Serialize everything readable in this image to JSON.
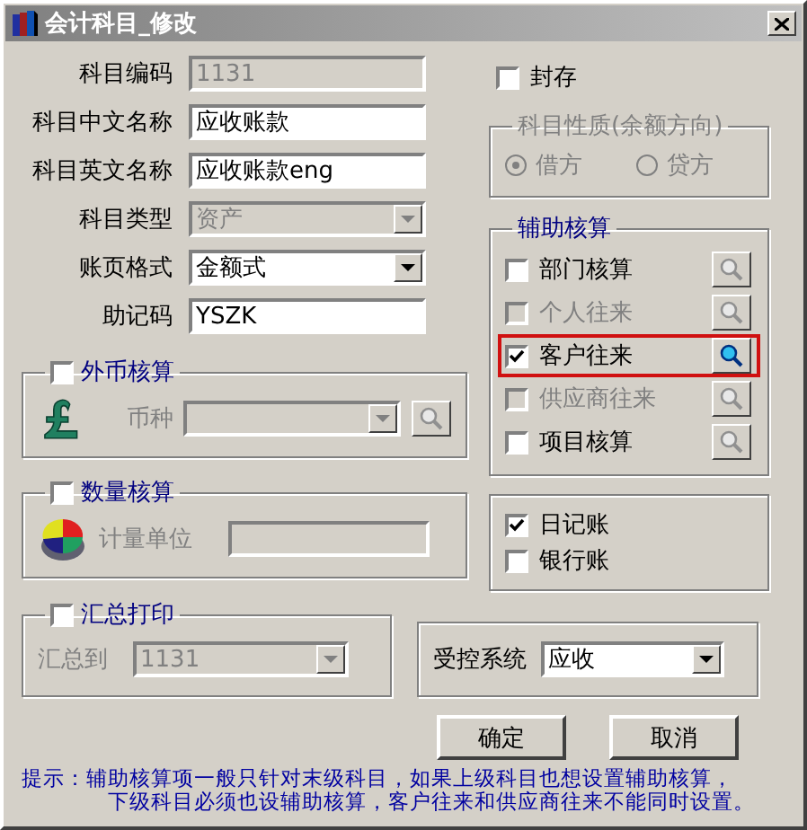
{
  "window": {
    "title": "会计科目_修改"
  },
  "fields": [
    {
      "label": "科目编码",
      "kind": "text",
      "value": "1131",
      "disabled": true
    },
    {
      "label": "科目中文名称",
      "kind": "text",
      "value": "应收账款",
      "disabled": false
    },
    {
      "label": "科目英文名称",
      "kind": "text",
      "value": "应收账款eng",
      "disabled": false
    },
    {
      "label": "科目类型",
      "kind": "select",
      "value": "资产",
      "disabled": true
    },
    {
      "label": "账页格式",
      "kind": "select",
      "value": "金额式",
      "disabled": false
    },
    {
      "label": "助记码",
      "kind": "text",
      "value": "YSZK",
      "disabled": false
    }
  ],
  "foreign_currency": {
    "label": "外币核算",
    "checked": false,
    "field_label": "币种"
  },
  "quantity": {
    "label": "数量核算",
    "checked": false,
    "field_label": "计量单位"
  },
  "summary_print": {
    "label": "汇总打印",
    "checked": false,
    "field_label": "汇总到",
    "value": "1131"
  },
  "sealed": {
    "label": "封存",
    "checked": false
  },
  "balance_direction": {
    "title": "科目性质(余额方向)",
    "options": [
      {
        "label": "借方",
        "selected": true
      },
      {
        "label": "贷方",
        "selected": false
      }
    ]
  },
  "auxiliary": {
    "title": "辅助核算",
    "items": [
      {
        "label": "部门核算",
        "checked": false,
        "disabled": false,
        "highlighted": false
      },
      {
        "label": "个人往来",
        "checked": false,
        "disabled": true,
        "highlighted": false
      },
      {
        "label": "客户往来",
        "checked": true,
        "disabled": false,
        "highlighted": true
      },
      {
        "label": "供应商往来",
        "checked": false,
        "disabled": true,
        "highlighted": false
      },
      {
        "label": "项目核算",
        "checked": false,
        "disabled": false,
        "highlighted": false
      }
    ]
  },
  "journals": [
    {
      "label": "日记账",
      "checked": true
    },
    {
      "label": "银行账",
      "checked": false
    }
  ],
  "controlled_system": {
    "label": "受控系统",
    "value": "应收"
  },
  "buttons": [
    {
      "label": "确定"
    },
    {
      "label": "取消"
    }
  ],
  "hint": {
    "lines": [
      "提示：辅助核算项一般只针对末级科目，如果上级科目也想设置辅助核算，",
      "下级科目必须也设辅助核算，客户往来和供应商往来不能同时设置。"
    ]
  }
}
